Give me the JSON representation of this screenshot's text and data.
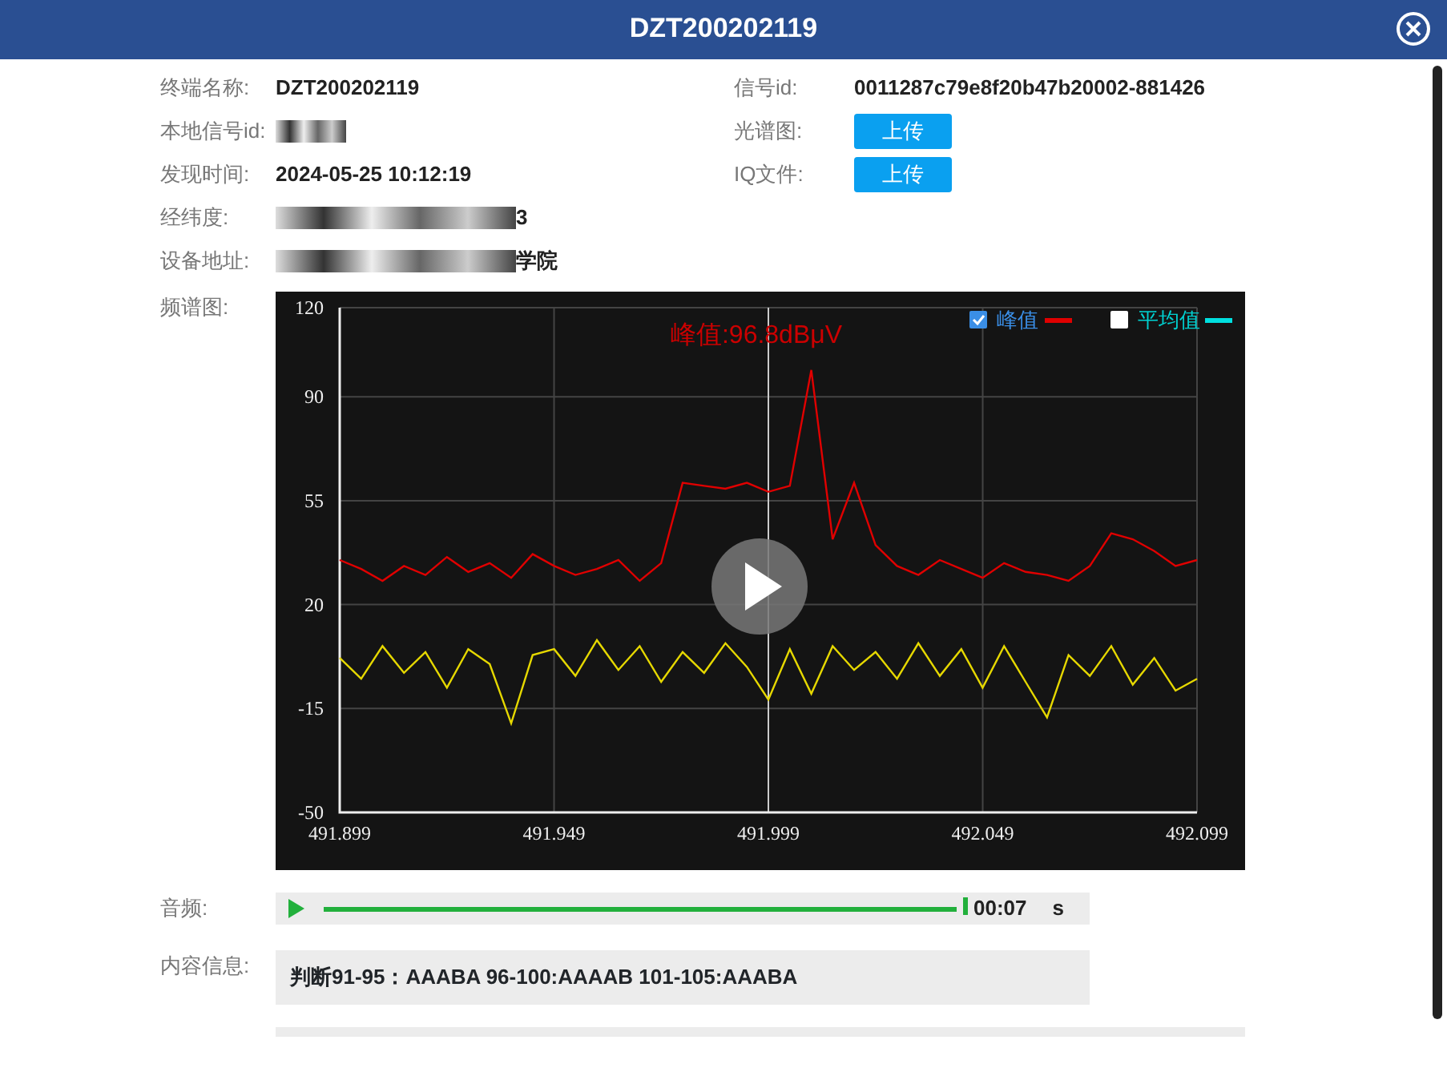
{
  "dialog": {
    "title": "DZT200202119"
  },
  "fields": [
    {
      "kind": "text",
      "label": "终端名称:",
      "value": "DZT200202119"
    },
    {
      "kind": "text",
      "label": "信号id:",
      "value": "0011287c79e8f20b47b20002-881426"
    },
    {
      "kind": "redacted",
      "label": "本地信号id:"
    },
    {
      "kind": "button",
      "label": "光谱图:",
      "button": "上传"
    },
    {
      "kind": "text",
      "label": "发现时间:",
      "value": "2024-05-25 10:12:19"
    },
    {
      "kind": "button",
      "label": "IQ文件:",
      "button": "上传"
    },
    {
      "kind": "redacted",
      "label": "经纬度:",
      "visible_text": "3"
    },
    {
      "kind": "blank"
    },
    {
      "kind": "redacted",
      "label": "设备地址:",
      "visible_text": "学院"
    }
  ],
  "spectrum": {
    "label": "频谱图:",
    "legend": [
      {
        "label": "峰值",
        "checked": true,
        "color": "#e00000"
      },
      {
        "label": "平均值",
        "checked": false,
        "color": "#00e0e0"
      }
    ],
    "chart_data": {
      "type": "line",
      "x": [
        491.899,
        491.904,
        491.909,
        491.914,
        491.919,
        491.924,
        491.929,
        491.934,
        491.939,
        491.944,
        491.949,
        491.954,
        491.959,
        491.964,
        491.969,
        491.974,
        491.979,
        491.984,
        491.989,
        491.994,
        491.999,
        492.004,
        492.009,
        492.014,
        492.019,
        492.024,
        492.029,
        492.034,
        492.039,
        492.044,
        492.049,
        492.054,
        492.059,
        492.064,
        492.069,
        492.074,
        492.079,
        492.084,
        492.089,
        492.094,
        492.099
      ],
      "series": [
        {
          "color": "#e00000",
          "values": [
            35,
            32,
            28,
            33,
            30,
            36,
            31,
            34,
            29,
            37,
            33,
            30,
            32,
            35,
            28,
            34,
            61,
            60,
            59,
            61,
            58,
            60,
            99,
            42,
            61,
            40,
            33,
            30,
            35,
            32,
            29,
            34,
            31,
            30,
            28,
            33,
            44,
            42,
            38,
            33,
            35
          ]
        },
        {
          "color": "#e6d800",
          "values": [
            2,
            -5,
            6,
            -3,
            4,
            -8,
            5,
            0,
            -20,
            3,
            5,
            -4,
            8,
            -2,
            6,
            -6,
            4,
            -3,
            7,
            -1,
            -12,
            5,
            -10,
            6,
            -2,
            4,
            -5,
            7,
            -4,
            5,
            -8,
            6,
            -6,
            -18,
            3,
            -4,
            6,
            -7,
            2,
            -9,
            -5
          ]
        }
      ],
      "grid": true,
      "ref_lines": [
        {
          "axis": "x",
          "value": 491.999
        }
      ],
      "xlim": [
        491.899,
        492.099
      ],
      "ylim": [
        -50,
        120
      ],
      "xticks": [
        491.899,
        491.949,
        491.999,
        492.049,
        492.099
      ],
      "yticks": [
        -50,
        -15,
        20,
        55,
        90,
        120
      ],
      "annotations": [
        "峰值:96.8dBμV"
      ]
    }
  },
  "audio": {
    "label": "音频:",
    "level": 1,
    "time": "00:07",
    "unit": "s"
  },
  "content": {
    "label": "内容信息:",
    "text": "判断91-95：AAABA 96-100:AAAAB 101-105:AAABA"
  }
}
